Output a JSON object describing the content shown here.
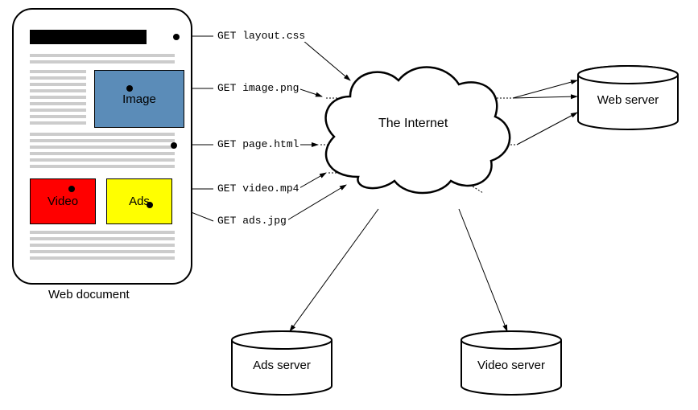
{
  "doc": {
    "label": "Web document",
    "image_label": "Image",
    "video_label": "Video",
    "ads_label": "Ads"
  },
  "cloud_label": "The Internet",
  "servers": {
    "web": "Web server",
    "ads": "Ads server",
    "video": "Video server"
  },
  "requests": {
    "layout": "GET layout.css",
    "image": "GET image.png",
    "page": "GET page.html",
    "video": "GET video.mp4",
    "ads": "GET ads.jpg"
  },
  "colors": {
    "image_box": "#5b8cb8",
    "video_box": "#ff0000",
    "ads_box": "#ffff00"
  }
}
